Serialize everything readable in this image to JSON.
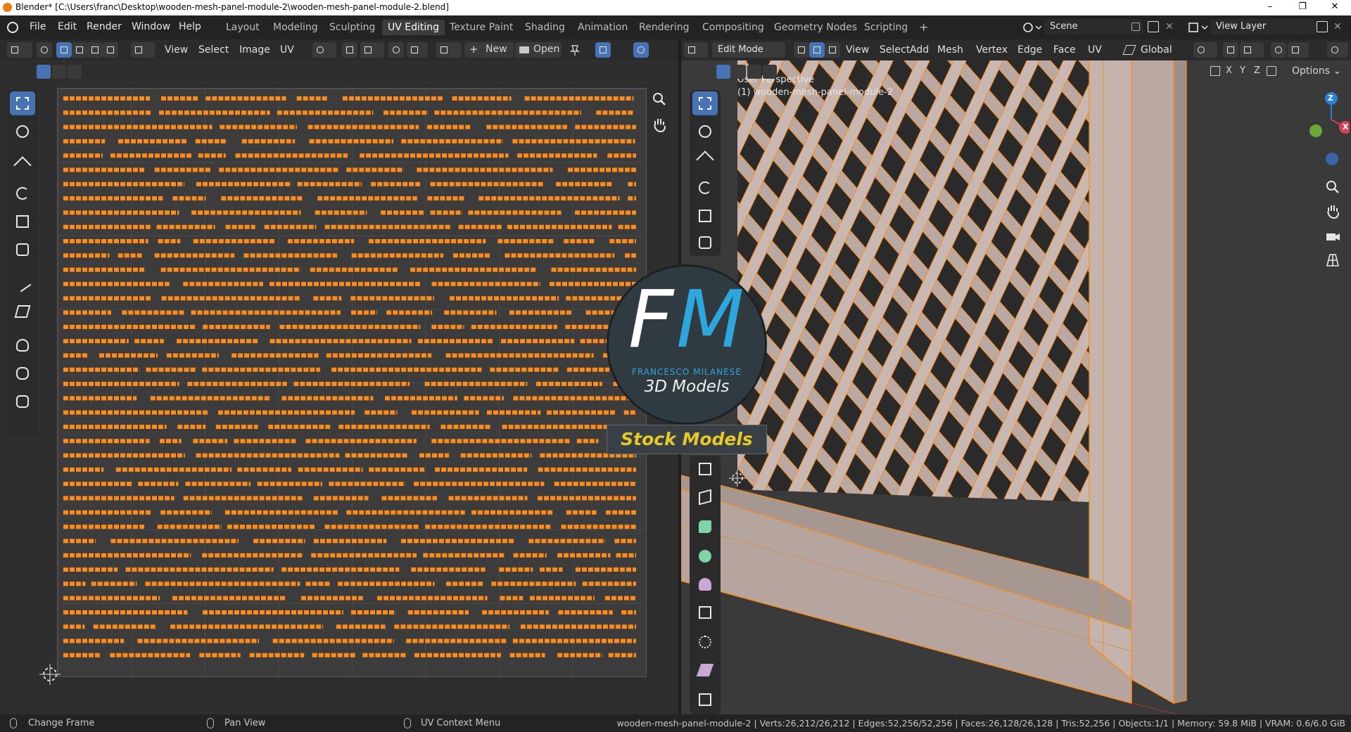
{
  "window": {
    "title": "Blender* [C:\\Users\\franc\\Desktop\\wooden-mesh-panel-module-2\\wooden-mesh-panel-module-2.blend]",
    "minimize": "–",
    "maximize": "❐",
    "close": "✕"
  },
  "menu": [
    "File",
    "Edit",
    "Render",
    "Window",
    "Help"
  ],
  "workspaces": [
    "Layout",
    "Modeling",
    "Sculpting",
    "UV Editing",
    "Texture Paint",
    "Shading",
    "Animation",
    "Rendering",
    "Compositing",
    "Geometry Nodes",
    "Scripting"
  ],
  "active_workspace": "UV Editing",
  "add_workspace": "+",
  "scene": {
    "name": "Scene",
    "view_layer": "View Layer"
  },
  "uv_header": {
    "menus": [
      "View",
      "Select",
      "Image",
      "UV"
    ],
    "new_label": "New",
    "open_label": "Open"
  },
  "viewport_header": {
    "mode": "Edit Mode",
    "menus": [
      "View",
      "Select",
      "Add",
      "Mesh",
      "Vertex",
      "Edge",
      "Face",
      "UV"
    ],
    "transform": "Global",
    "axes": [
      "X",
      "Y",
      "Z"
    ],
    "options_label": "Options"
  },
  "viewport": {
    "perspective_label": "User Perspective",
    "object_label": "(1) wooden-mesh-panel-module-2",
    "gizmo": {
      "z": "Z",
      "x": "X"
    }
  },
  "logo": {
    "letter1": "F",
    "letter2": "M",
    "name": "FRANCESCO MILANESE",
    "tagline": "3D Models",
    "banner": "Stock Models",
    "colors": {
      "accent": "#2da6de",
      "banner_text": "#e8c728"
    }
  },
  "status": {
    "left_action": "Change Frame",
    "middle_action": "Pan View",
    "right_action": "UV Context Menu",
    "stats": "wooden-mesh-panel-module-2 | Verts:26,212/26,212 | Edges:52,256/52,256 | Faces:26,128/26,128 | Tris:52,256 | Objects:1/1 | Memory: 59.8 MiB | VRAM: 0.6/6.0 GiB"
  },
  "colors": {
    "selection": "#ff8c1a",
    "active_button": "#4772b3",
    "wood": "#b9a9a2"
  }
}
